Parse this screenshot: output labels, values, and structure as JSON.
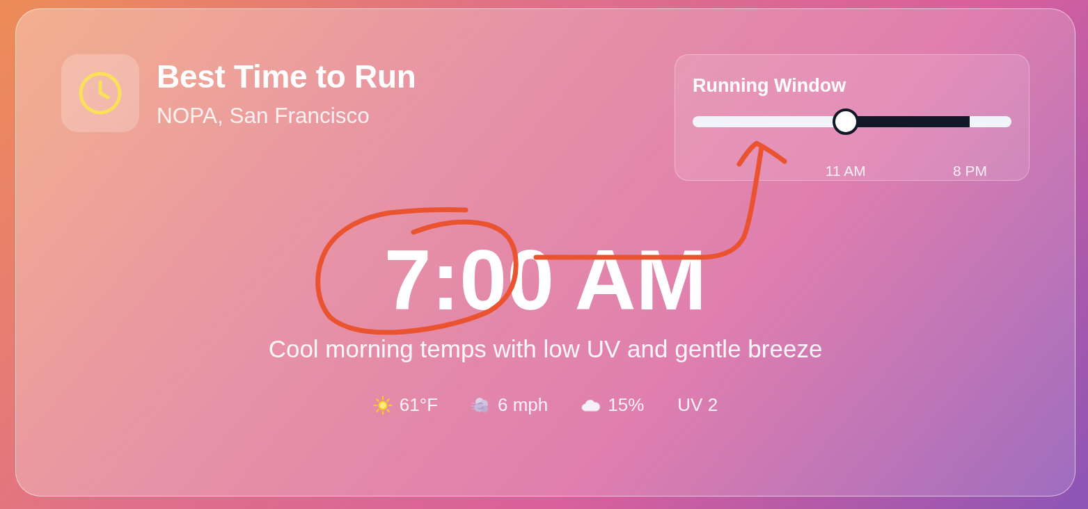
{
  "header": {
    "title": "Best Time to Run",
    "subtitle": "NOPA, San Francisco"
  },
  "running_window": {
    "title": "Running Window",
    "range": [
      {
        "label": "11 AM",
        "level": 0.48
      },
      {
        "label": "8 PM",
        "level": 0.87
      }
    ]
  },
  "best_time": "7:00 AM",
  "summary": "Cool morning temps with low UV and gentle breeze",
  "conditions": [
    {
      "kind": "temperature",
      "text": "61°F"
    },
    {
      "kind": "wind",
      "text": "6 mph"
    },
    {
      "kind": "cloud",
      "text": "15%"
    },
    {
      "kind": "uv",
      "text": "UV 2"
    }
  ]
}
